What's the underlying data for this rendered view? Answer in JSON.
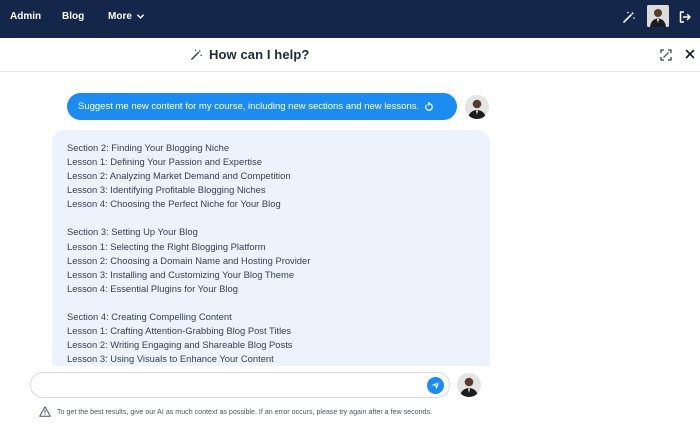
{
  "nav": {
    "items": [
      {
        "label": "Admin"
      },
      {
        "label": "Blog"
      },
      {
        "label": "More"
      }
    ]
  },
  "panel": {
    "title": "How can I help?"
  },
  "conversation": {
    "user_message": "Suggest me new content for my course, including new sections and new lessons.",
    "ai_lines": [
      "Section 2: Finding Your Blogging Niche",
      "Lesson 1: Defining Your Passion and Expertise",
      "Lesson 2: Analyzing Market Demand and Competition",
      "Lesson 3: Identifying Profitable Blogging Niches",
      "Lesson 4: Choosing the Perfect Niche for Your Blog",
      "",
      "Section 3: Setting Up Your Blog",
      "Lesson 1: Selecting the Right Blogging Platform",
      "Lesson 2: Choosing a Domain Name and Hosting Provider",
      "Lesson 3: Installing and Customizing Your Blog Theme",
      "Lesson 4: Essential Plugins for Your Blog",
      "",
      "Section 4: Creating Compelling Content",
      "Lesson 1: Crafting Attention-Grabbing Blog Post Titles",
      "Lesson 2: Writing Engaging and Shareable Blog Posts",
      "Lesson 3: Using Visuals to Enhance Your Content"
    ]
  },
  "composer": {
    "value": "",
    "placeholder": ""
  },
  "footer": {
    "note": "To get the best results, give our AI as much context as possible. If an error occurs, please try again after a few seconds."
  },
  "icons": {
    "wand": "magic-wand-icon",
    "logout": "logout-icon",
    "expand": "expand-icon",
    "close": "close-icon",
    "retry": "retry-icon",
    "send": "send-icon",
    "warning": "warning-icon",
    "chevron": "chevron-down-icon"
  },
  "colors": {
    "topbar": "#14264a",
    "accent": "#1d8cf0",
    "ai_bubble": "#ecf3fd"
  }
}
